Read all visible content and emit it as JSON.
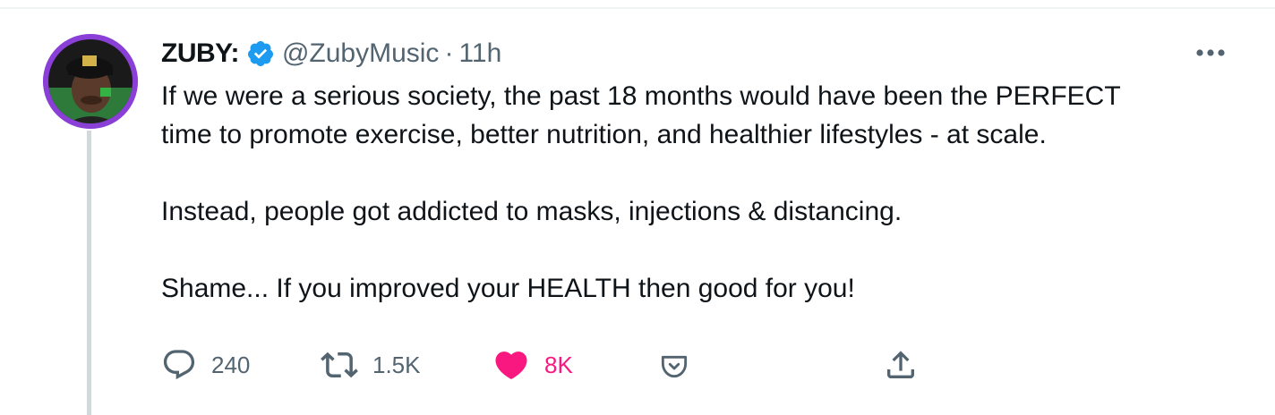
{
  "tweet": {
    "author": {
      "display_name": "ZUBY:",
      "handle": "@ZubyMusic",
      "verified": true
    },
    "separator": "·",
    "time": "11h",
    "paragraphs": [
      "If we were a serious society, the past 18 months would have been the PERFECT",
      "time to promote exercise, better nutrition, and healthier lifestyles - at scale.",
      "Instead, people got addicted to masks, injections & distancing.",
      "Shame... If you improved your HEALTH then good for you!"
    ],
    "actions": {
      "reply": {
        "icon": "reply-icon",
        "count": "240"
      },
      "retweet": {
        "icon": "retweet-icon",
        "count": "1.5K"
      },
      "like": {
        "icon": "heart-icon",
        "count": "8K",
        "liked": true
      },
      "tip": {
        "icon": "tip-jar-icon"
      },
      "share": {
        "icon": "share-icon"
      }
    },
    "more_icon": "more-icon"
  },
  "colors": {
    "text": "#0f1419",
    "secondary_text": "#536471",
    "verified_blue": "#1d9bf0",
    "like_pink": "#f91880",
    "thread_line": "#cfd9de",
    "avatar_ring": "#8a3fd6"
  }
}
